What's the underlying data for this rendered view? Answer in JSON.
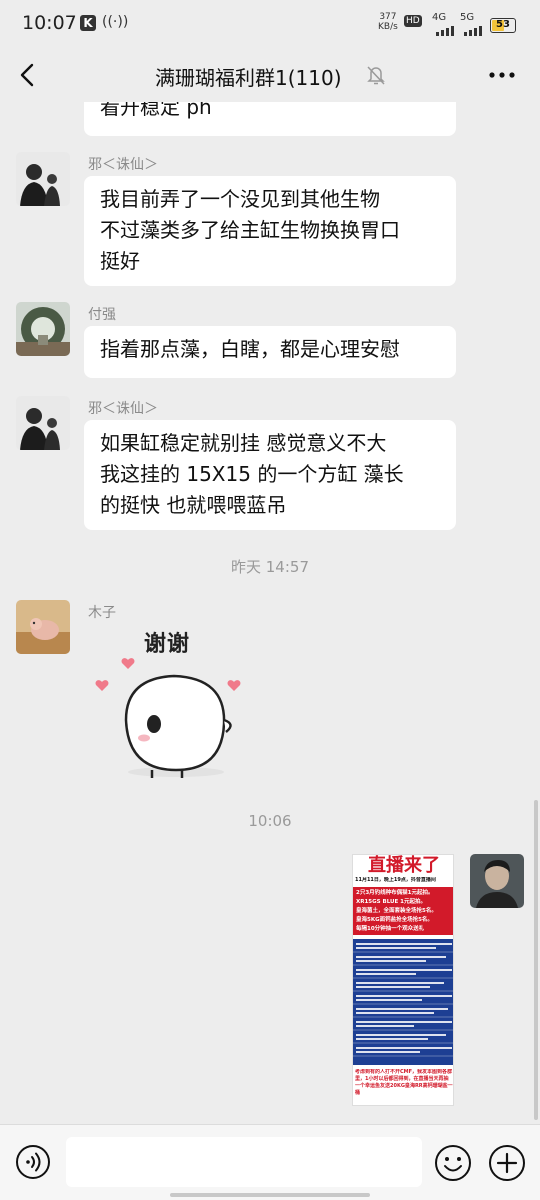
{
  "status_bar": {
    "time": "10:07",
    "app_badge": "K",
    "speed_value": "377",
    "speed_unit": "KB/s",
    "hd_label": "HD",
    "net1_label": "4G",
    "net2_label": "5G",
    "battery_level": "53"
  },
  "header": {
    "title": "满珊瑚福利群1(110)"
  },
  "messages": [
    {
      "sender": "",
      "text": "看开稳定 ph"
    },
    {
      "sender": "邪＜诛仙＞",
      "lines": [
        "我目前弄了一个没见到其他生物",
        "不过藻类多了给主缸生物换换胃口",
        "挺好"
      ]
    },
    {
      "sender": "付强",
      "text": "指着那点藻，白瞎，都是心理安慰"
    },
    {
      "sender": "邪＜诛仙＞",
      "lines": [
        "如果缸稳定就别挂 感觉意义不大",
        "我这挂的 15X15 的一个方缸 藻长",
        "的挺快 也就喂喂蓝吊"
      ]
    },
    {
      "sender": "木子",
      "sticker_text": "谢谢"
    }
  ],
  "timestamps": [
    "昨天 14:57",
    "10:06"
  ],
  "poster": {
    "headline": "直播来了",
    "line1": "11月11日，晚上19点，抖音直播间",
    "line2": "2只3月钓线种布偶猫1元起拍。",
    "line3": "XR15GS BLUE 1元起拍。",
    "line4": "皇海菌土，全面套装全场抢5名。",
    "line5": "皇海5KG面钙盐抢全场抢5名。",
    "line6": "每隔10分钟抽一个观众送礼",
    "footer": "考虑到有的人打不开CMF，我发本图到各群里，1小时以后都回得到，在直播当天再抽一个幸运鱼友送20KG皇海RR高钙珊瑚盐一桶"
  },
  "input": {
    "placeholder": ""
  },
  "colors": {
    "background": "#ededed",
    "bubble": "#ffffff",
    "poster_red": "#d21a2a",
    "poster_blue": "#1d3f93",
    "battery_fill": "#f3c33a"
  }
}
